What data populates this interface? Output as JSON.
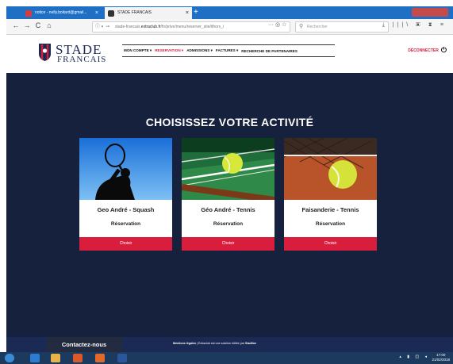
{
  "browser": {
    "tabs": [
      {
        "label": "notice - nelly.boitard@gmail..."
      },
      {
        "label": "STADE FRANCAIS"
      }
    ],
    "url_prefix": "stade-francais.",
    "url_domain": "extraclub.fr",
    "url_path": "/fo/prive/menu/reserver_site/ithors_i",
    "search_placeholder": "Rechercher",
    "new_tab_glyph": "+",
    "close_glyph": "×",
    "nav_glyphs": {
      "back": "←",
      "forward": "→",
      "reload": "C",
      "home": "⌂"
    },
    "url_icons": "ⓘ ◐ ⊸",
    "url_actions": "··· ◎ ☆",
    "right_tools": "⤓ |||\\ ▣ ♜ ≡"
  },
  "site": {
    "logo": {
      "line1": "STADE",
      "line2": "FRANCAIS"
    },
    "menu": [
      {
        "label": "MON COMPTE ▾",
        "active": false
      },
      {
        "label": "RESERVATION ▾",
        "active": true
      },
      {
        "label": "ADMISSIONS ▾",
        "active": false
      },
      {
        "label": "FACTURES ▾",
        "active": false
      },
      {
        "label": "RECHERCHE DE PARTENAIRES",
        "active": false
      }
    ],
    "disconnect_label": "DÉCONNECTER",
    "power_glyph": "⏻",
    "heading": "CHOISISSEZ VOTRE ACTIVITÉ",
    "cards": [
      {
        "title": "Geo André - Squash",
        "subtitle": "Réservation",
        "button": "Choisir"
      },
      {
        "title": "Géo André - Tennis",
        "subtitle": "Réservation",
        "button": "Choisir"
      },
      {
        "title": "Faisanderie - Tennis",
        "subtitle": "Réservation",
        "button": "Choisir"
      }
    ],
    "footer": {
      "contact": "Contactez-nous",
      "legal_bold": "Mentions légales",
      "legal_sep": " | ",
      "legal_text": "Extraclub est une solution éditée par ",
      "legal_brand": "Stadline"
    }
  },
  "taskbar": {
    "tray_glyphs": "▴ ▮ ◫ ◂",
    "time": "17:00",
    "date": "21/02/2018"
  },
  "colors": {
    "brand_red": "#d81e3c",
    "navy": "#16213d",
    "footer_navy": "#1b2a55"
  }
}
